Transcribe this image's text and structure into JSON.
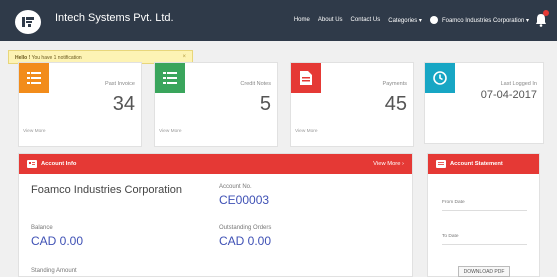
{
  "header": {
    "brand": "Intech Systems Pvt. Ltd.",
    "nav": [
      "Home",
      "About Us",
      "Contact Us",
      "Categories ▾"
    ],
    "user": "Foamco Industries Corporation ▾"
  },
  "notification": {
    "bold": "Hello !",
    "text": " You have 1 notification",
    "close": "×"
  },
  "cards": [
    {
      "label": "Past Invoice",
      "value": "34",
      "view": "View More",
      "color": "#f28c1b"
    },
    {
      "label": "Credit Notes",
      "value": "5",
      "view": "View More",
      "color": "#3aa55c"
    },
    {
      "label": "Payments",
      "value": "45",
      "view": "View More",
      "color": "#e53935"
    }
  ],
  "last_logged": {
    "label": "Last Logged In",
    "value": "07-04-2017",
    "color": "#17a6c4"
  },
  "account_info": {
    "title": "Account Info",
    "view_more": "View More ›",
    "company": "Foamco Industries Corporation",
    "account_no_label": "Account No.",
    "account_no": "CE00003",
    "balance_label": "Balance",
    "balance": "CAD 0.00",
    "outstanding_label": "Outstanding Orders",
    "outstanding": "CAD 0.00",
    "standing_label": "Standing Amount"
  },
  "account_statement": {
    "title": "Account Statement",
    "from_date": "From Date",
    "to_date": "To Date",
    "download": "DOWNLOAD PDF"
  }
}
